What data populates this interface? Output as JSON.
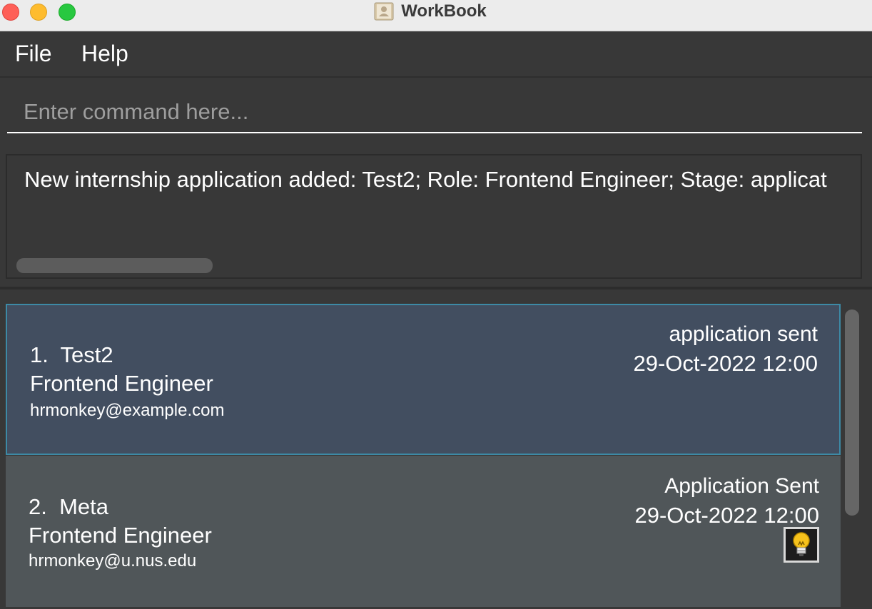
{
  "window": {
    "title": "WorkBook"
  },
  "menu": {
    "file": "File",
    "help": "Help"
  },
  "command": {
    "placeholder": "Enter command here...",
    "value": ""
  },
  "result": {
    "message": "New internship application added: Test2; Role: Frontend Engineer; Stage: applicat"
  },
  "applications": [
    {
      "index": "1.",
      "company": "Test2",
      "role": "Frontend Engineer",
      "email": "hrmonkey@example.com",
      "stage": "application sent",
      "datetime": "29-Oct-2022 12:00"
    },
    {
      "index": "2.",
      "company": "Meta",
      "role": "Frontend Engineer",
      "email": "hrmonkey@u.nus.edu",
      "stage": "Application Sent",
      "datetime": "29-Oct-2022 12:00",
      "icon": "lightbulb-icon"
    }
  ],
  "colors": {
    "selected_card": "#424e60",
    "selected_border": "#3d8aa6",
    "card": "#505659",
    "background": "#383838"
  }
}
